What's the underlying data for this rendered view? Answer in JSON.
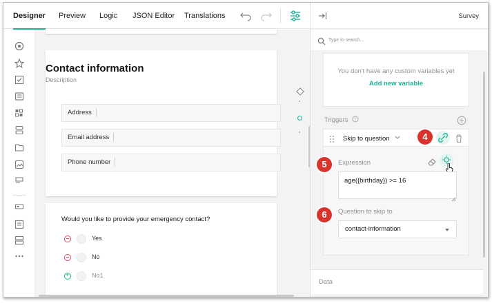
{
  "tabs": [
    {
      "label": "Designer",
      "active": true
    },
    {
      "label": "Preview"
    },
    {
      "label": "Logic"
    },
    {
      "label": "JSON Editor"
    },
    {
      "label": "Translations"
    }
  ],
  "toolbar": {
    "undo_icon": "undo-icon",
    "redo_icon": "redo-icon",
    "settings_icon": "settings-icon"
  },
  "sidebar_icons": [
    "radiogroup-icon",
    "rating-icon",
    "checkbox-icon",
    "dropdown-icon",
    "matrix-icon",
    "ranking-icon",
    "panel-icon",
    "image-icon",
    "text-icon",
    "boolean-icon",
    "comment-icon",
    "multipletext-icon",
    "more-icon"
  ],
  "page": {
    "title": "Contact information",
    "description": "Description",
    "fields": [
      {
        "label": "Address"
      },
      {
        "label": "Email address"
      },
      {
        "label": "Phone number"
      }
    ]
  },
  "question": {
    "title": "Would you like to provide your emergency contact?",
    "choices": [
      {
        "label": "Yes",
        "action": "remove"
      },
      {
        "label": "No",
        "action": "remove"
      },
      {
        "label": "No1",
        "action": "add"
      }
    ]
  },
  "panel": {
    "title": "Survey",
    "collapse_icon": "collapse-panel-icon",
    "search_placeholder": "Type to search...",
    "variables": {
      "empty_text": "You don't have any custom variables yet",
      "add_label": "Add new variable"
    },
    "triggers_label": "Triggers",
    "trigger": {
      "type": "Skip to question"
    },
    "expression_label": "Expression",
    "expression_value": "age({birthday}) >= 16",
    "skip_label": "Question to skip to",
    "skip_value": "contact-information",
    "data_label": "Data"
  },
  "badges": [
    "4",
    "5",
    "6"
  ],
  "colors": {
    "accent": "#19b394",
    "badge": "#d9342b",
    "remove": "#e5465f"
  }
}
